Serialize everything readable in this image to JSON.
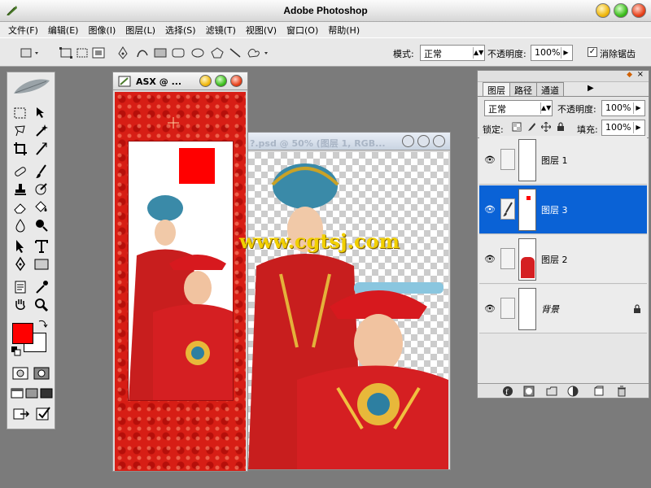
{
  "app": {
    "title": "Adobe Photoshop"
  },
  "menu": [
    "文件(F)",
    "编辑(E)",
    "图像(I)",
    "图层(L)",
    "选择(S)",
    "滤镜(T)",
    "视图(V)",
    "窗口(O)",
    "帮助(H)"
  ],
  "options": {
    "mode_label": "模式:",
    "mode_value": "正常",
    "opacity_label": "不透明度:",
    "opacity_value": "100%",
    "antialias_label": "消除锯齿",
    "antialias_checked": "✓"
  },
  "doc1": {
    "title": "ASX @ ..."
  },
  "doc2": {
    "title": "?.psd @ 50% (图层 1, RGB..."
  },
  "watermark": "www.cgtsj.com",
  "layers_panel": {
    "tabs": [
      "图层",
      "路径",
      "通道"
    ],
    "blend_value": "正常",
    "opacity_label": "不透明度:",
    "opacity_value": "100%",
    "lock_label": "锁定:",
    "fill_label": "填充:",
    "fill_value": "100%",
    "layers": [
      {
        "name": "图层 1",
        "selected": false
      },
      {
        "name": "图层 3",
        "selected": true
      },
      {
        "name": "图层 2",
        "selected": false
      },
      {
        "name": "背景",
        "selected": false
      }
    ]
  },
  "colors": {
    "foreground": "#ff0000",
    "background": "#ffffff",
    "selection": "#0a62d6"
  }
}
